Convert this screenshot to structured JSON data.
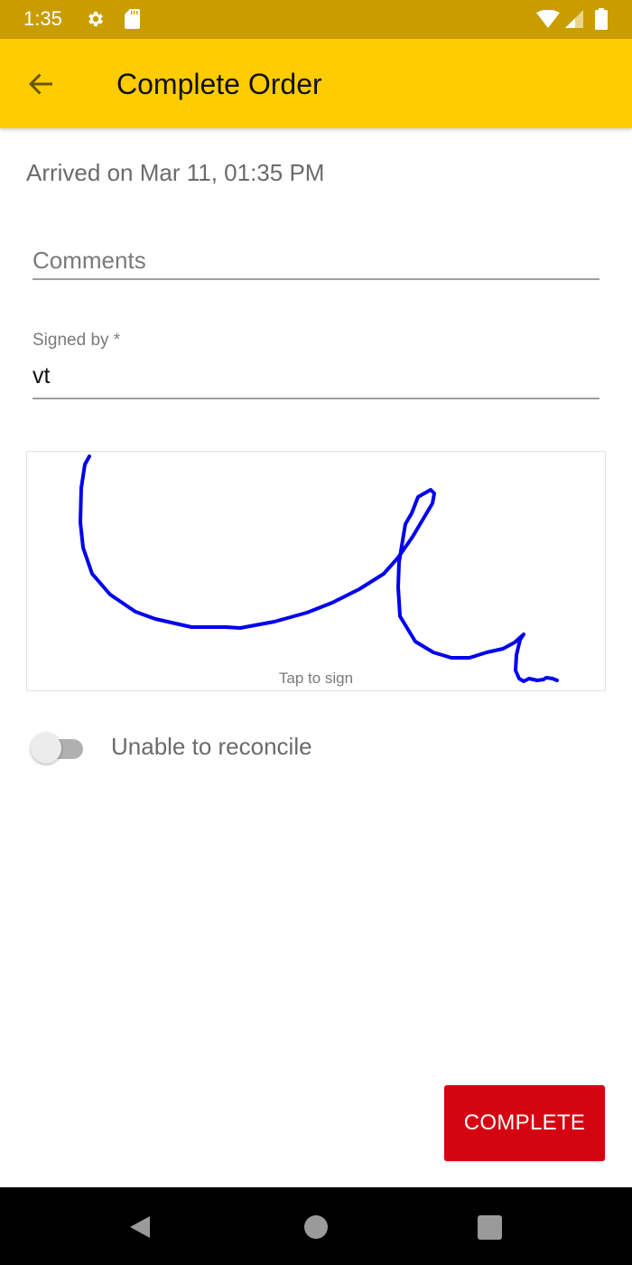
{
  "status_bar": {
    "time": "1:35",
    "icons": [
      "gear-icon",
      "sd-card-icon",
      "wifi-icon",
      "cell-signal-icon",
      "battery-icon"
    ]
  },
  "app_bar": {
    "title": "Complete Order",
    "back_icon": "arrow-back-icon",
    "background_color": "#ffcc00"
  },
  "arrival": {
    "text": "Arrived on Mar 11, 01:35 PM"
  },
  "form": {
    "comments": {
      "placeholder": "Comments",
      "value": ""
    },
    "signed_by": {
      "label": "Signed by *",
      "value": "vt"
    }
  },
  "signature_pad": {
    "hint": "Tap to sign",
    "stroke_color": "#0000ee",
    "has_signature": true
  },
  "unable_to_reconcile": {
    "label": "Unable to reconcile",
    "checked": false
  },
  "complete_button": {
    "label": "COMPLETE",
    "color": "#d50411"
  },
  "nav_bar": {
    "buttons": [
      "back-icon",
      "home-icon",
      "recents-icon"
    ]
  }
}
